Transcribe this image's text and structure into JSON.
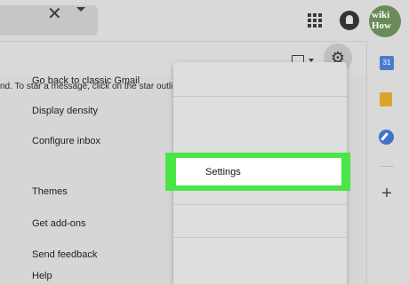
{
  "header": {
    "close_glyph": "✕",
    "avatar_line1": "wiki",
    "avatar_line2": "How"
  },
  "toolbar": {
    "gear_glyph": "⚙"
  },
  "message_area": {
    "empty_text": "nd. To star a message, click on the star outline"
  },
  "side_panel": {
    "calendar_label": "31",
    "plus_glyph": "+"
  },
  "settings_menu": {
    "items": [
      {
        "label": "Go back to classic Gmail"
      },
      {
        "label": "Display density"
      },
      {
        "label": "Configure inbox"
      },
      {
        "label": "Settings",
        "highlighted": true
      },
      {
        "label": "Themes"
      },
      {
        "label": "Get add-ons"
      },
      {
        "label": "Send feedback"
      },
      {
        "label": "Help"
      }
    ]
  },
  "colors": {
    "highlight": "#49e646",
    "calendar": "#4b7bd0",
    "keep": "#d9a62a",
    "tasks": "#3f72c9"
  }
}
